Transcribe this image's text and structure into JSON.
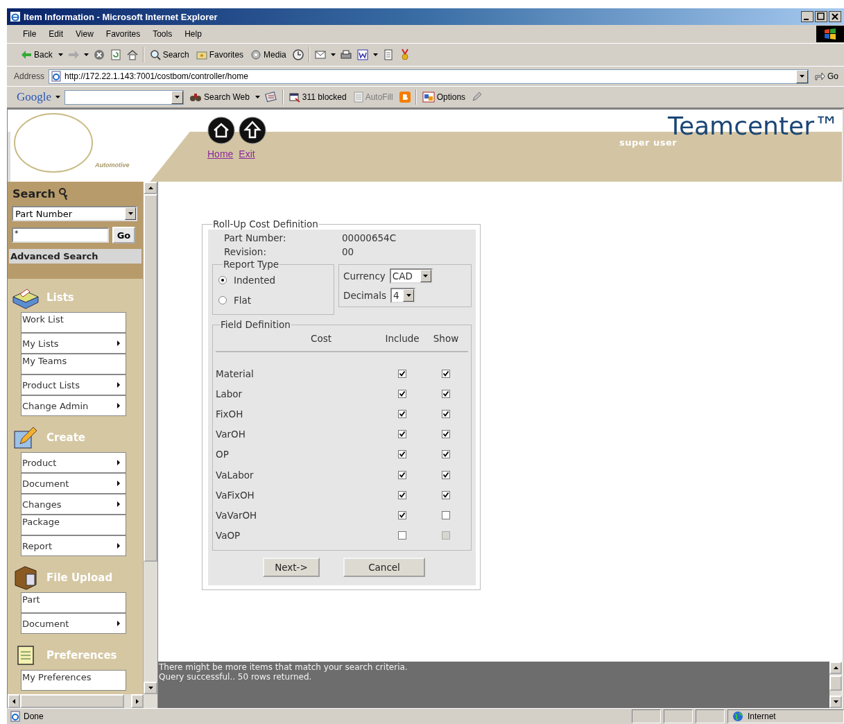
{
  "window": {
    "title": "Item Information - Microsoft Internet Explorer"
  },
  "menu": [
    "File",
    "Edit",
    "View",
    "Favorites",
    "Tools",
    "Help"
  ],
  "toolbar": {
    "back": "Back",
    "search": "Search",
    "favorites": "Favorites",
    "media": "Media"
  },
  "address_bar": {
    "label": "Address",
    "url": "http://172.22.1.143:7001/costbom/controller/home",
    "go": "Go"
  },
  "google_bar": {
    "logo": "Google",
    "search_web": "Search Web",
    "blocked": "311 blocked",
    "autofill": "AutoFill",
    "autofill_disabled": true,
    "options": "Options"
  },
  "header": {
    "logo_caption": "Automotive",
    "links": [
      "Home",
      "Exit"
    ],
    "user": "super user",
    "brand": "Teamcenter™"
  },
  "sidebar": {
    "search_title": "Search",
    "search_type": "Part Number",
    "search_value": "*",
    "go": "Go",
    "advanced": "Advanced Search",
    "sections": [
      {
        "title": "Lists",
        "items": [
          {
            "label": "Work List",
            "submenu": false
          },
          {
            "label": "My Lists",
            "submenu": true
          },
          {
            "label": "My Teams",
            "submenu": false
          },
          {
            "label": "Product Lists",
            "submenu": true
          },
          {
            "label": "Change Admin",
            "submenu": true
          }
        ]
      },
      {
        "title": "Create",
        "items": [
          {
            "label": "Product",
            "submenu": true
          },
          {
            "label": "Document",
            "submenu": true
          },
          {
            "label": "Changes",
            "submenu": true
          },
          {
            "label": "Package",
            "submenu": false
          },
          {
            "label": "Report",
            "submenu": true
          }
        ]
      },
      {
        "title": "File Upload",
        "items": [
          {
            "label": "Part",
            "submenu": false
          },
          {
            "label": "Document",
            "submenu": true
          }
        ]
      },
      {
        "title": "Preferences",
        "items": [
          {
            "label": "My Preferences",
            "submenu": false
          }
        ]
      }
    ]
  },
  "form": {
    "legend": "Roll-Up Cost Definition",
    "part_number_label": "Part Number:",
    "part_number": "00000654C",
    "revision_label": "Revision:",
    "revision": "00",
    "report_type": {
      "legend": "Report Type",
      "options": [
        {
          "label": "Indented",
          "selected": true
        },
        {
          "label": "Flat",
          "selected": false
        }
      ]
    },
    "currency_label": "Currency",
    "currency": "CAD",
    "decimals_label": "Decimals",
    "decimals": "4",
    "field_definition": {
      "legend": "Field Definition",
      "columns": [
        "Cost",
        "Include",
        "Show"
      ],
      "rows": [
        {
          "name": "Material",
          "include": true,
          "show": true,
          "show_disabled": false
        },
        {
          "name": "Labor",
          "include": true,
          "show": true,
          "show_disabled": false
        },
        {
          "name": "FixOH",
          "include": true,
          "show": true,
          "show_disabled": false
        },
        {
          "name": "VarOH",
          "include": true,
          "show": true,
          "show_disabled": false
        },
        {
          "name": "OP",
          "include": true,
          "show": true,
          "show_disabled": false
        },
        {
          "name": "VaLabor",
          "include": true,
          "show": true,
          "show_disabled": false
        },
        {
          "name": "VaFixOH",
          "include": true,
          "show": true,
          "show_disabled": false
        },
        {
          "name": "VaVarOH",
          "include": true,
          "show": false,
          "show_disabled": false
        },
        {
          "name": "VaOP",
          "include": false,
          "show": false,
          "show_disabled": true
        }
      ]
    },
    "buttons": [
      "Next->",
      "Cancel"
    ]
  },
  "messages": [
    "There might be more items that match your search criteria.",
    "Query successful.. 50 rows returned."
  ],
  "status_bar": {
    "text": "Done",
    "zone": "Internet"
  }
}
